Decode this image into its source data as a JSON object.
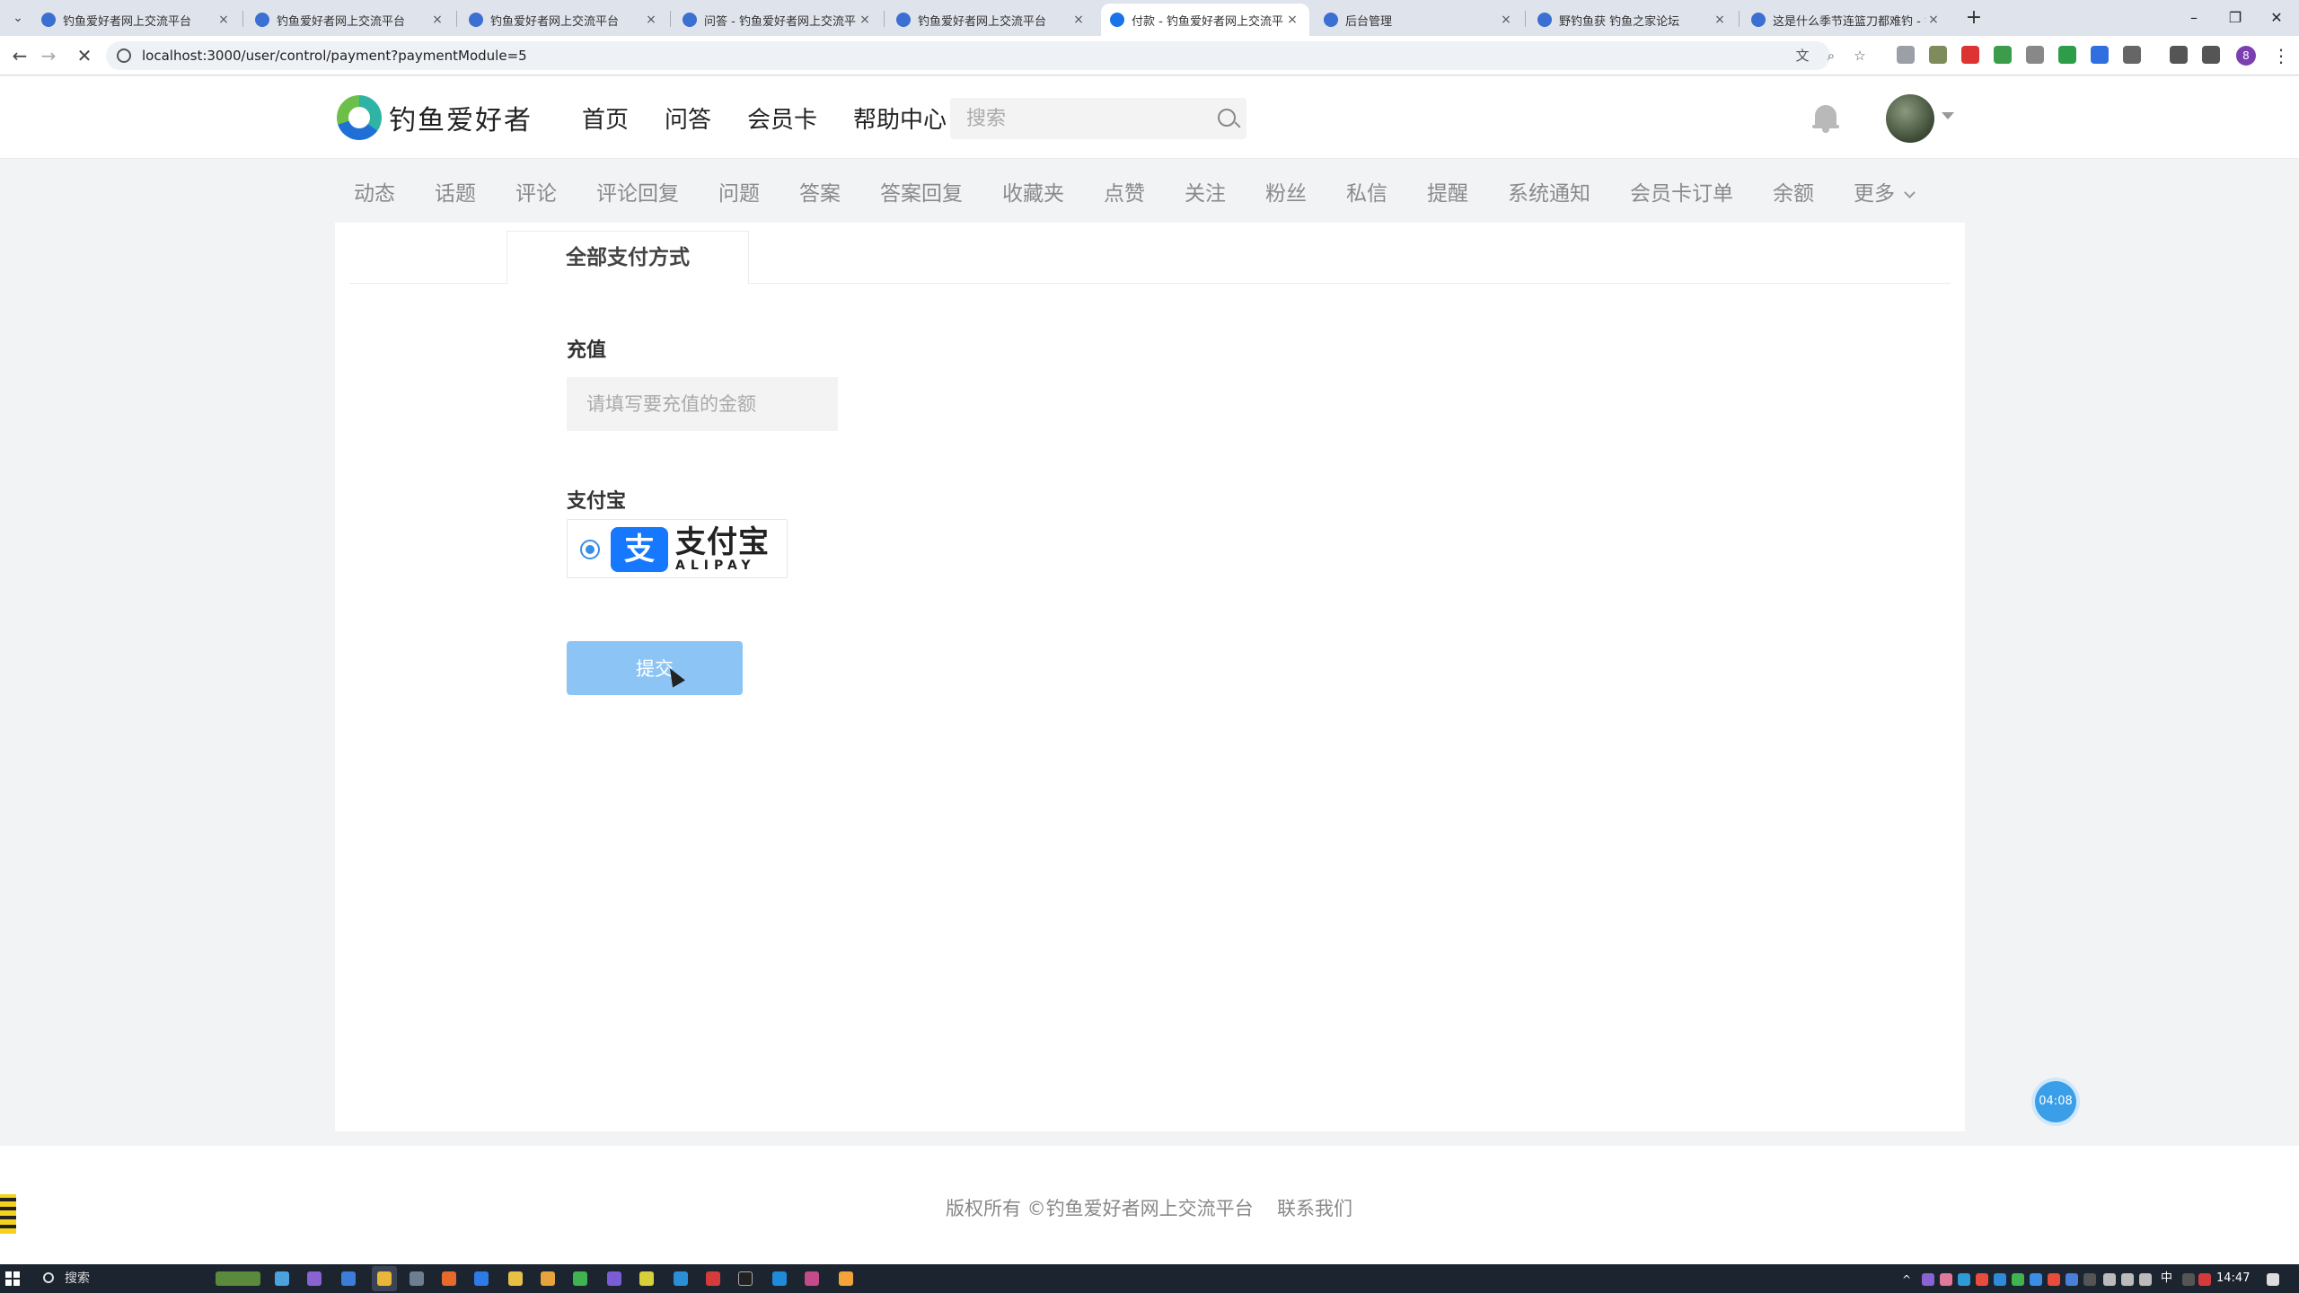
{
  "browser": {
    "tabs": [
      {
        "title": "钓鱼爱好者网上交流平台",
        "active": false
      },
      {
        "title": "钓鱼爱好者网上交流平台",
        "active": false
      },
      {
        "title": "钓鱼爱好者网上交流平台",
        "active": false
      },
      {
        "title": "问答 - 钓鱼爱好者网上交流平台",
        "active": false
      },
      {
        "title": "钓鱼爱好者网上交流平台",
        "active": false
      },
      {
        "title": "付款 - 钓鱼爱好者网上交流平台",
        "active": true
      },
      {
        "title": "后台管理",
        "active": false
      },
      {
        "title": "野钓鱼获 钓鱼之家论坛",
        "active": false
      },
      {
        "title": "这是什么季节连篮刀都难钓 - 钓",
        "active": false
      }
    ],
    "new_tab_label": "+",
    "close_glyph": "×",
    "url": "localhost:3000/user/control/payment?paymentModule=5",
    "profile_initial": "8"
  },
  "header": {
    "logo_text": "钓鱼爱好者",
    "nav": [
      "首页",
      "问答",
      "会员卡",
      "帮助中心"
    ],
    "search_placeholder": "搜索"
  },
  "subnav": {
    "items": [
      "动态",
      "话题",
      "评论",
      "评论回复",
      "问题",
      "答案",
      "答案回复",
      "收藏夹",
      "点赞",
      "关注",
      "粉丝",
      "私信",
      "提醒",
      "系统通知",
      "会员卡订单",
      "余额"
    ],
    "more": "更多"
  },
  "payment": {
    "tab_label": "全部支付方式",
    "recharge_label": "充值",
    "amount_placeholder": "请填写要充值的金额",
    "amount_value": "",
    "method_label": "支付宝",
    "alipay_mark": "支",
    "alipay_cn": "支付宝",
    "alipay_en": "ALIPAY",
    "method_selected": true,
    "submit_label": "提交"
  },
  "floating_timer": "04:08",
  "footer": {
    "copyright": "版权所有 ©钓鱼爱好者网上交流平台",
    "contact": "联系我们"
  },
  "taskbar": {
    "search_label": "搜索",
    "lang": "中",
    "clock": "14:47"
  },
  "colors": {
    "accent": "#3a8ee6",
    "submit_button": "#8cc5f5",
    "alipay_blue": "#1677ff",
    "page_background": "#f2f3f5"
  }
}
